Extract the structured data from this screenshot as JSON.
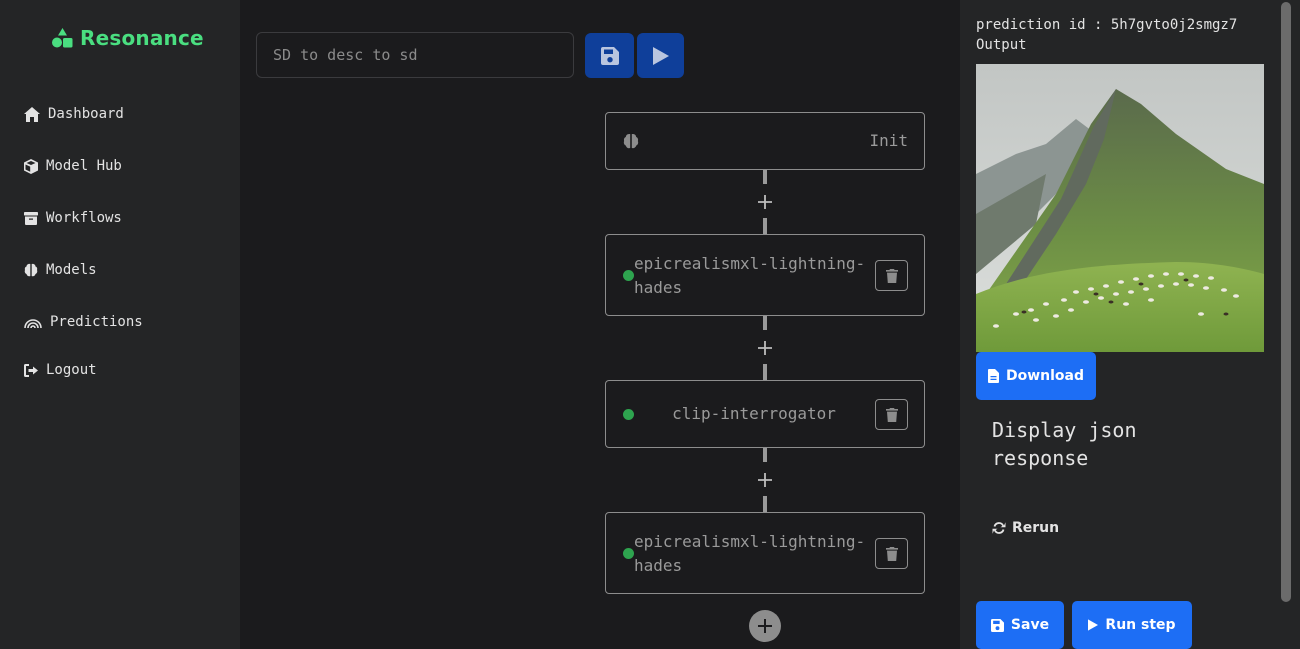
{
  "brand": {
    "name": "Resonance",
    "color": "#4ade80",
    "icon": "shapes-icon"
  },
  "sidebar": {
    "items": [
      {
        "label": "Dashboard",
        "icon": "home-icon"
      },
      {
        "label": "Model Hub",
        "icon": "cube-icon"
      },
      {
        "label": "Workflows",
        "icon": "archive-icon"
      },
      {
        "label": "Models",
        "icon": "brain-icon"
      },
      {
        "label": "Predictions",
        "icon": "rainbow-icon"
      },
      {
        "label": "Logout",
        "icon": "logout-icon"
      }
    ]
  },
  "toolbar": {
    "workflow_name_placeholder": "SD to desc to sd",
    "save_icon": "floppy-icon",
    "run_icon": "play-icon"
  },
  "workflow": {
    "init_label": "Init",
    "steps": [
      {
        "label": "epicrealismxl-lightning-hades",
        "status": "ready",
        "status_color": "#2ea44f"
      },
      {
        "label": "clip-interrogator",
        "status": "ready",
        "status_color": "#2ea44f"
      },
      {
        "label": "epicrealismxl-lightning-hades",
        "status": "ready",
        "status_color": "#2ea44f"
      }
    ]
  },
  "output_panel": {
    "prediction_id": "prediction id : 5h7gvto0j2smgz7",
    "output_label": "Output",
    "download_label": "Download",
    "json_toggle_label": "Display json response",
    "rerun_label": "Rerun",
    "save_label": "Save",
    "run_step_label": "Run step",
    "accent_color": "#1d6ef5"
  }
}
